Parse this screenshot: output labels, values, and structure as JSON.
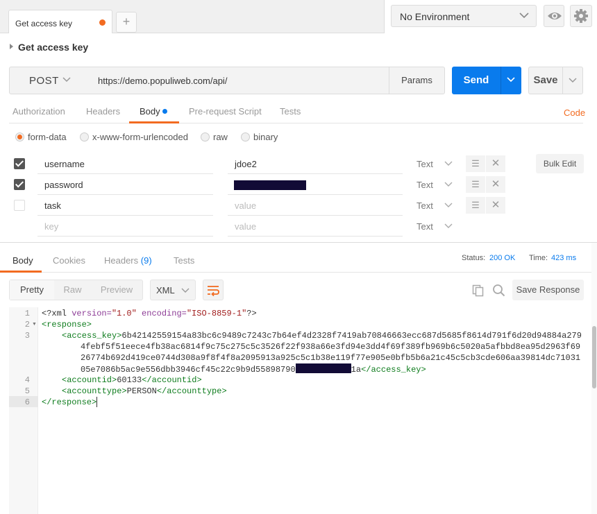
{
  "tabs": {
    "active_label": "Get access key",
    "new_tab_glyph": "+"
  },
  "environment": {
    "selected": "No Environment"
  },
  "request": {
    "name": "Get access key",
    "method": "POST",
    "url": "https://demo.populiweb.com/api/",
    "params_label": "Params",
    "send_label": "Send",
    "save_label": "Save"
  },
  "request_tabs": {
    "authorization": "Authorization",
    "headers": "Headers",
    "body": "Body",
    "prerequest": "Pre-request Script",
    "tests": "Tests",
    "code": "Code"
  },
  "body_types": {
    "form_data": "form-data",
    "urlencoded": "x-www-form-urlencoded",
    "raw": "raw",
    "binary": "binary"
  },
  "form_rows": [
    {
      "key": "username",
      "value": "jdoe2",
      "type": "Text",
      "checked": true
    },
    {
      "key": "password",
      "value": "",
      "type": "Text",
      "checked": true
    },
    {
      "key": "task",
      "value": "value",
      "type": "Text",
      "checked": false
    },
    {
      "key": "key",
      "value": "value",
      "type": "Text"
    }
  ],
  "bulk_edit_label": "Bulk Edit",
  "response_tabs": {
    "body": "Body",
    "cookies": "Cookies",
    "headers": "Headers",
    "headers_count": "(9)",
    "tests": "Tests"
  },
  "response_status": {
    "status_label": "Status:",
    "status_value": "200 OK",
    "time_label": "Time:",
    "time_value": "423 ms"
  },
  "view_modes": {
    "pretty": "Pretty",
    "raw": "Raw",
    "preview": "Preview"
  },
  "format": "XML",
  "save_response_label": "Save Response",
  "code_lines": {
    "l1_decl_open": "<?xml ",
    "l1_attr1": "version=",
    "l1_val1": "\"1.0\"",
    "l1_attr2": " encoding=",
    "l1_val2": "\"ISO-8859-1\"",
    "l1_decl_close": "?>",
    "l2": "<response>",
    "l3_open": "<access_key>",
    "l3a": "6b42142559154a83bc6c9489c7243c7b64ef4d2328f7419ab70846663ecc687d5685f8614d791f6d20d94884a279",
    "l3b": "4febf5f51eece4fb38ac6814f9c75c275c5c3526f22f938a66e3fd94e3dd4f69f389fb969b6c5020a5afbbd8ea95d2963f69",
    "l3c": "26774b692d419ce0744d308a9f8f4f8a2095913a925c5c1b38e119f77e905e0bfb5b6a21c45c5cb3cde606aa39814dc71031",
    "l3d": "05e7086b5ac9e556dbb3946cf45c22c9b9d55898790",
    "l3_tail": "1a",
    "l3_close": "</access_key>",
    "l4_open": "<accountid>",
    "l4_val": "60133",
    "l4_close": "</accountid>",
    "l5_open": "<accounttype>",
    "l5_val": "PERSON",
    "l5_close": "</accounttype>",
    "l6": "</response>"
  },
  "line_numbers": [
    "1",
    "2",
    "3",
    "4",
    "5",
    "6"
  ],
  "colors": {
    "accent_orange": "#f26b21",
    "send_blue": "#097bed",
    "status_blue": "#097bed"
  },
  "icons": {
    "chevron": "chevron-down-icon",
    "eye": "eye-icon",
    "gear": "gear-icon",
    "menu": "hamburger-icon",
    "close": "close-icon",
    "wrap": "wrap-lines-icon",
    "copy": "copy-icon",
    "search": "search-icon"
  }
}
